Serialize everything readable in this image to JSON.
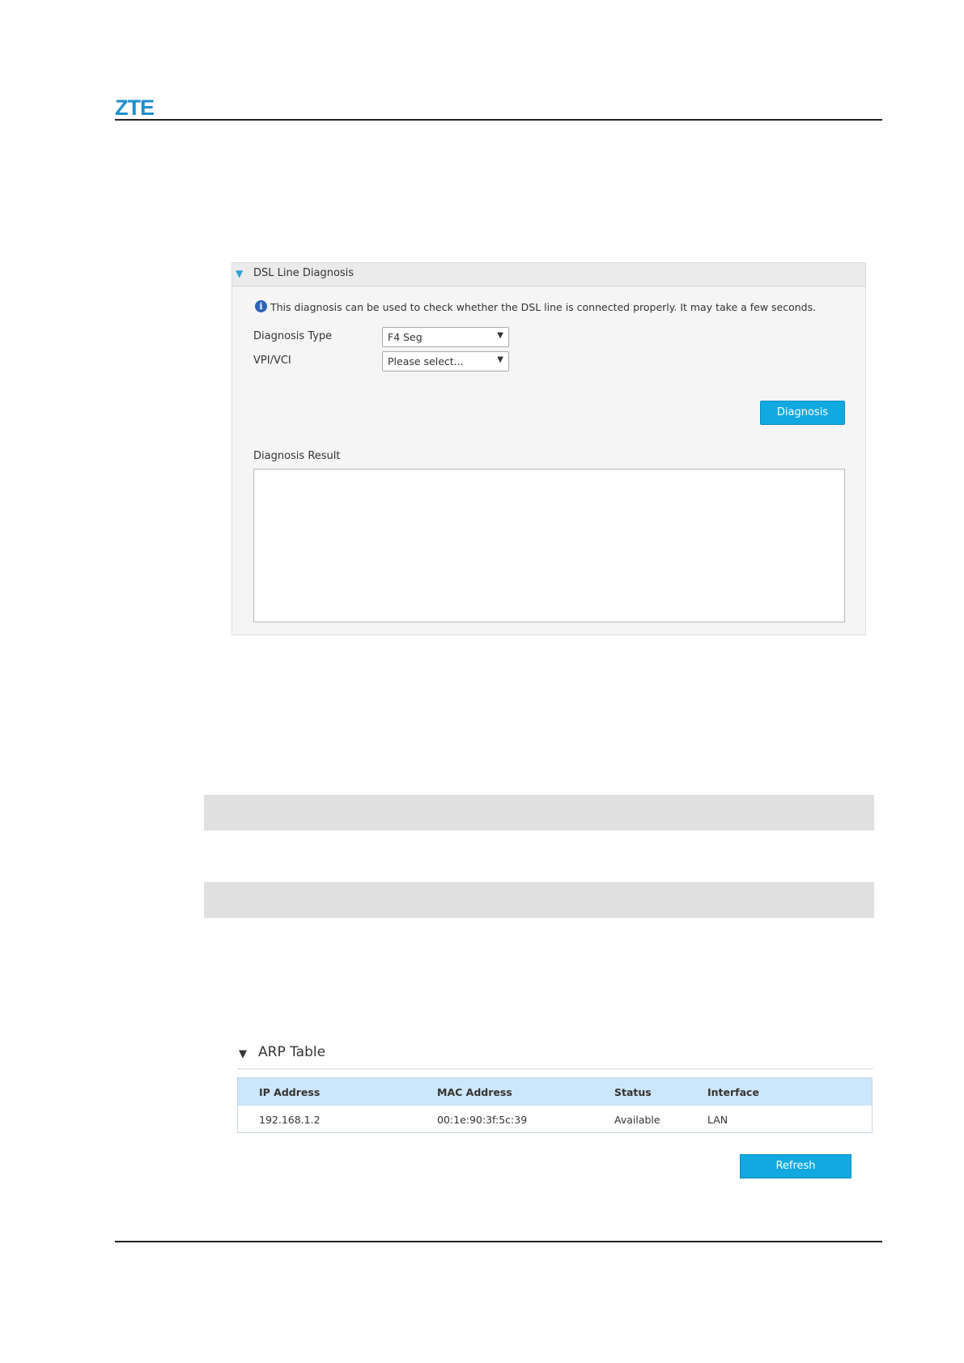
{
  "header": {
    "logo_text": "ZTE"
  },
  "dsl": {
    "title": "DSL Line Diagnosis",
    "info": "This diagnosis can be used to check whether the DSL line is connected properly. It may take a few seconds.",
    "diagnosis_type_label": "Diagnosis Type",
    "diagnosis_type_value": "F4 Seg",
    "vpi_vci_label": "VPI/VCI",
    "vpi_vci_value": "Please select...",
    "diagnosis_button": "Diagnosis",
    "result_label": "Diagnosis Result",
    "result_value": ""
  },
  "arp": {
    "title": "ARP Table",
    "columns": [
      "IP Address",
      "MAC Address",
      "Status",
      "Interface"
    ],
    "rows": [
      [
        "192.168.1.2",
        "00:1e:90:3f:5c:39",
        "Available",
        "LAN"
      ]
    ],
    "refresh_button": "Refresh"
  },
  "colors": {
    "brand": "#1d8fce",
    "button": "#12a8e0",
    "table_header": "#cde7fa",
    "panel_bg": "#f5f5f5"
  },
  "icons": [
    "collapse-triangle-icon",
    "info-icon",
    "dropdown-arrow-icon"
  ]
}
